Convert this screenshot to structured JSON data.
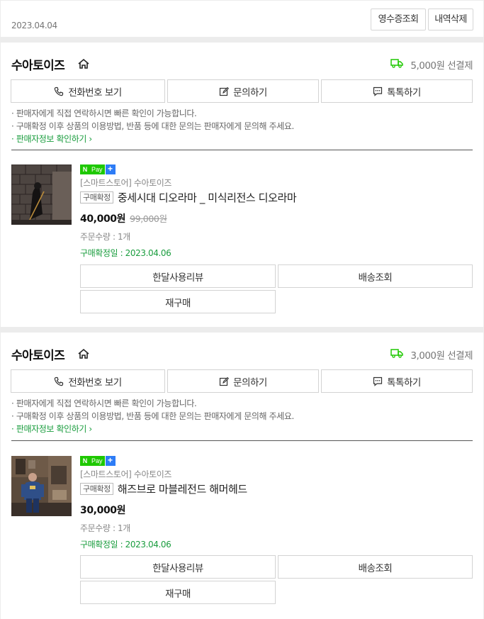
{
  "header": {
    "date": "2023.04.04",
    "receipt_label": "영수증조회",
    "delete_label": "내역삭제"
  },
  "colors": {
    "accent_green": "#1a9d3e",
    "npay_green": "#1ec800",
    "npay_blue": "#2d7cf6"
  },
  "orders": [
    {
      "seller_name": "수아토이즈",
      "shipping_fee": "5,000원",
      "shipping_type": "선결제",
      "actions": {
        "phone": "전화번호 보기",
        "inquiry": "문의하기",
        "talk": "톡톡하기"
      },
      "notice": {
        "line1": "· 판매자에게 직접 연락하시면 빠른 확인이 가능합니다.",
        "line2": "· 구매확정 이후 상품의 이용방법, 반품 등에 대한 문의는 판매자에게 문의해 주세요.",
        "link": "· 판매자정보 확인하기 ›"
      },
      "product": {
        "badge_n": "N",
        "badge_pay": "Pay",
        "badge_plus": "+",
        "store": "[스마트스토어] 수아토이즈",
        "status": "구매확정",
        "title": "중세시대 디오라마 _ 미식리전스 디오라마",
        "price": "40,000원",
        "original_price": "99,000원",
        "quantity": "주문수량 : 1개",
        "confirm_date": "구매확정일 : 2023.04.06"
      },
      "buttons": {
        "review": "한달사용리뷰",
        "tracking": "배송조회",
        "rebuy": "재구매"
      }
    },
    {
      "seller_name": "수아토이즈",
      "shipping_fee": "3,000원",
      "shipping_type": "선결제",
      "actions": {
        "phone": "전화번호 보기",
        "inquiry": "문의하기",
        "talk": "톡톡하기"
      },
      "notice": {
        "line1": "· 판매자에게 직접 연락하시면 빠른 확인이 가능합니다.",
        "line2": "· 구매확정 이후 상품의 이용방법, 반품 등에 대한 문의는 판매자에게 문의해 주세요.",
        "link": "· 판매자정보 확인하기 ›"
      },
      "product": {
        "badge_n": "N",
        "badge_pay": "Pay",
        "badge_plus": "+",
        "store": "[스마트스토어] 수아토이즈",
        "status": "구매확정",
        "title": "해즈브로 마블레전드 해머헤드",
        "price": "30,000원",
        "original_price": "",
        "quantity": "주문수량 : 1개",
        "confirm_date": "구매확정일 : 2023.04.06"
      },
      "buttons": {
        "review": "한달사용리뷰",
        "tracking": "배송조회",
        "rebuy": "재구매"
      }
    }
  ]
}
